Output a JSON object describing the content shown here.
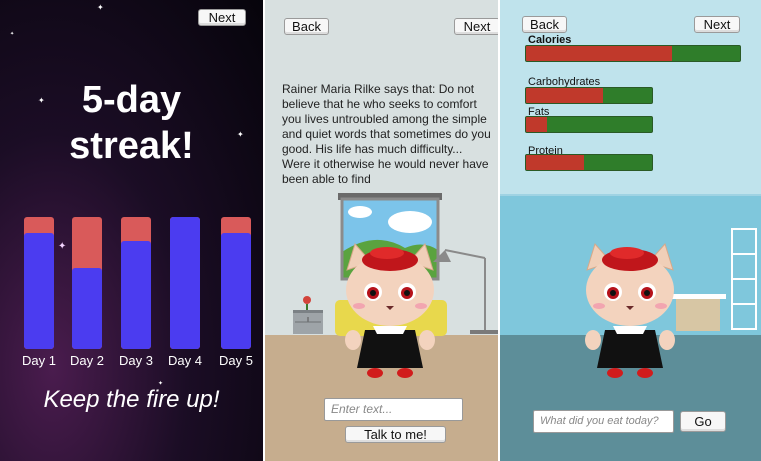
{
  "panel1": {
    "next_label": "Next",
    "title_line1": "5-day",
    "title_line2": "streak!",
    "days": [
      {
        "label": "Day 1",
        "fill": 0.88
      },
      {
        "label": "Day 2",
        "fill": 0.61
      },
      {
        "label": "Day 3",
        "fill": 0.82
      },
      {
        "label": "Day 4",
        "fill": 1.0
      },
      {
        "label": "Day 5",
        "fill": 0.88
      }
    ],
    "tagline": "Keep the fire up!"
  },
  "panel2": {
    "back_label": "Back",
    "next_label": "Next",
    "quote": "Rainer Maria Rilke says that: Do not believe that he who seeks to comfort you lives untroubled among the simple and quiet words that sometimes do you good. His life has much difficulty... Were it otherwise he would never have been able to find",
    "input_placeholder": "Enter text...",
    "talk_label": "Talk to me!"
  },
  "panel3": {
    "back_label": "Back",
    "next_label": "Next",
    "nutrients": [
      {
        "label": "Calories",
        "fill": 0.68
      },
      {
        "label": "Carbohydrates",
        "fill": 0.61
      },
      {
        "label": "Fats",
        "fill": 0.17
      },
      {
        "label": "Protein",
        "fill": 0.46
      }
    ],
    "input_placeholder": "What did you eat today?",
    "go_label": "Go"
  },
  "colors": {
    "bar_fill": "#4b3cf0",
    "bar_remaining": "#d95a5a",
    "nutrient_consumed": "#c0392b",
    "nutrient_remaining": "#2f7d2a"
  }
}
